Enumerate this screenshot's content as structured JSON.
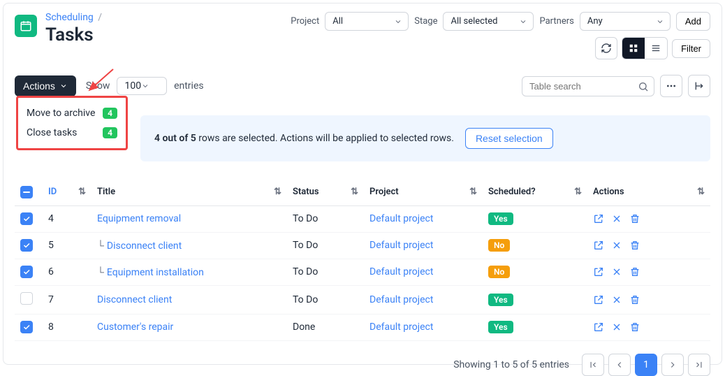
{
  "breadcrumb": {
    "parent": "Scheduling",
    "sep": "/"
  },
  "page_title": "Tasks",
  "filters": {
    "project_label": "Project",
    "project_value": "All",
    "stage_label": "Stage",
    "stage_value": "All selected",
    "partners_label": "Partners",
    "partners_value": "Any",
    "add_label": "Add",
    "filter_label": "Filter"
  },
  "actions_button": "Actions",
  "show_label": "Show",
  "page_size": "100",
  "entries_label": "entries",
  "search_placeholder": "Table search",
  "dropdown": {
    "items": [
      {
        "label": "Move to archive",
        "count": "4"
      },
      {
        "label": "Close tasks",
        "count": "4"
      }
    ]
  },
  "banner": {
    "bold": "4 out of 5",
    "rest": " rows are selected. Actions will be applied to selected rows.",
    "reset": "Reset selection"
  },
  "columns": {
    "id": "ID",
    "title": "Title",
    "status": "Status",
    "project": "Project",
    "scheduled": "Scheduled?",
    "actions": "Actions"
  },
  "rows": [
    {
      "checked": true,
      "id": "4",
      "tree": false,
      "title": "Equipment removal",
      "status": "To Do",
      "project": "Default project",
      "scheduled": "Yes"
    },
    {
      "checked": true,
      "id": "5",
      "tree": true,
      "title": "Disconnect client",
      "status": "To Do",
      "project": "Default project",
      "scheduled": "No"
    },
    {
      "checked": true,
      "id": "6",
      "tree": true,
      "title": "Equipment installation",
      "status": "To Do",
      "project": "Default project",
      "scheduled": "No"
    },
    {
      "checked": false,
      "id": "7",
      "tree": false,
      "title": "Disconnect client",
      "status": "To Do",
      "project": "Default project",
      "scheduled": "Yes"
    },
    {
      "checked": true,
      "id": "8",
      "tree": false,
      "title": "Customer's repair",
      "status": "Done",
      "project": "Default project",
      "scheduled": "Yes"
    }
  ],
  "footer_text": "Showing 1 to 5 of 5 entries",
  "current_page": "1"
}
